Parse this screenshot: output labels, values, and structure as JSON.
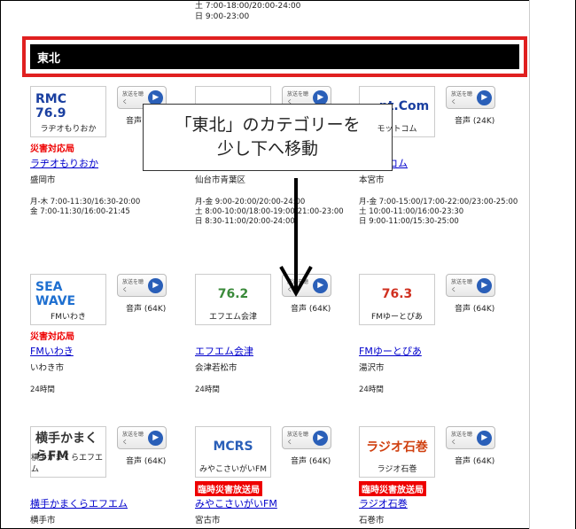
{
  "top_times": [
    "土 7:00-18:00/20:00-24:00",
    "日 9:00-23:00"
  ],
  "region_title": "東北",
  "listen_label": "放送を聴く",
  "callout": [
    "「東北」のカテゴリーを",
    "少し下へ移動"
  ],
  "stations": [
    {
      "logo_text": "RMC 76.9",
      "logo_caption": "ラヂオもりおか",
      "logo_color": "#1a3fa0",
      "quality": "音声 (24K)",
      "badge": "災害対応局",
      "badge_style": "text",
      "name": "ラヂオもりおか",
      "city": "盛岡市",
      "schedule": [
        "月-木 7:00-11:30/16:30-20:00",
        "金 7:00-11:30/16:00-21:45"
      ]
    },
    {
      "logo_text": "",
      "logo_caption": "",
      "logo_color": "#444",
      "quality": "",
      "badge": "",
      "badge_style": "none",
      "name": "",
      "city": "仙台市青葉区",
      "schedule": [
        "月-金 9:00-20:00/20:00-24:00",
        "土 8:00-10:00/18:00-19:00/21:00-23:00",
        "日 8:30-11:00/20:00-24:00"
      ]
    },
    {
      "logo_text": "...pt.Com",
      "logo_caption": "モットコム",
      "logo_color": "#1a3fa0",
      "quality": "音声 (24K)",
      "badge": "局",
      "badge_style": "text",
      "name": "モットコム",
      "city": "本宮市",
      "schedule": [
        "月-金 7:00-15:00/17:00-22:00/23:00-25:00",
        "土 10:00-11:00/16:00-23:30",
        "日 9:00-11:00/15:30-25:00"
      ]
    },
    {
      "logo_text": "SEA WAVE",
      "logo_caption": "FMいわき",
      "logo_color": "#1e6fd0",
      "quality": "音声 (64K)",
      "badge": "災害対応局",
      "badge_style": "text",
      "name": "FMいわき",
      "city": "いわき市",
      "schedule": [
        "24時間"
      ]
    },
    {
      "logo_text": "76.2",
      "logo_caption": "エフエム会津",
      "logo_color": "#3a8a3a",
      "quality": "音声 (64K)",
      "badge": "",
      "badge_style": "none",
      "name": "エフエム会津",
      "city": "会津若松市",
      "schedule": [
        "24時間"
      ]
    },
    {
      "logo_text": "76.3",
      "logo_caption": "FMゆーとぴあ",
      "logo_color": "#d03020",
      "quality": "音声 (64K)",
      "badge": "",
      "badge_style": "none",
      "name": "FMゆーとぴあ",
      "city": "湯沢市",
      "schedule": [
        "24時間"
      ]
    },
    {
      "logo_text": "横手かまくらFM",
      "logo_caption": "横手かまくらエフエム",
      "logo_color": "#333",
      "quality": "音声 (64K)",
      "badge": "",
      "badge_style": "none",
      "name": "横手かまくらエフエム",
      "city": "横手市",
      "schedule": []
    },
    {
      "logo_text": "MCRS",
      "logo_caption": "みやこさいがいFM",
      "logo_color": "#2a5fb8",
      "quality": "音声 (64K)",
      "badge": "臨時災害放送局",
      "badge_style": "box",
      "name": "みやこさいがいFM",
      "city": "宮古市",
      "schedule": []
    },
    {
      "logo_text": "ラジオ石巻",
      "logo_caption": "ラジオ石巻",
      "logo_color": "#d04010",
      "quality": "音声 (64K)",
      "badge": "臨時災害放送局",
      "badge_style": "box",
      "name": "ラジオ石巻",
      "city": "石巻市",
      "schedule": []
    }
  ]
}
